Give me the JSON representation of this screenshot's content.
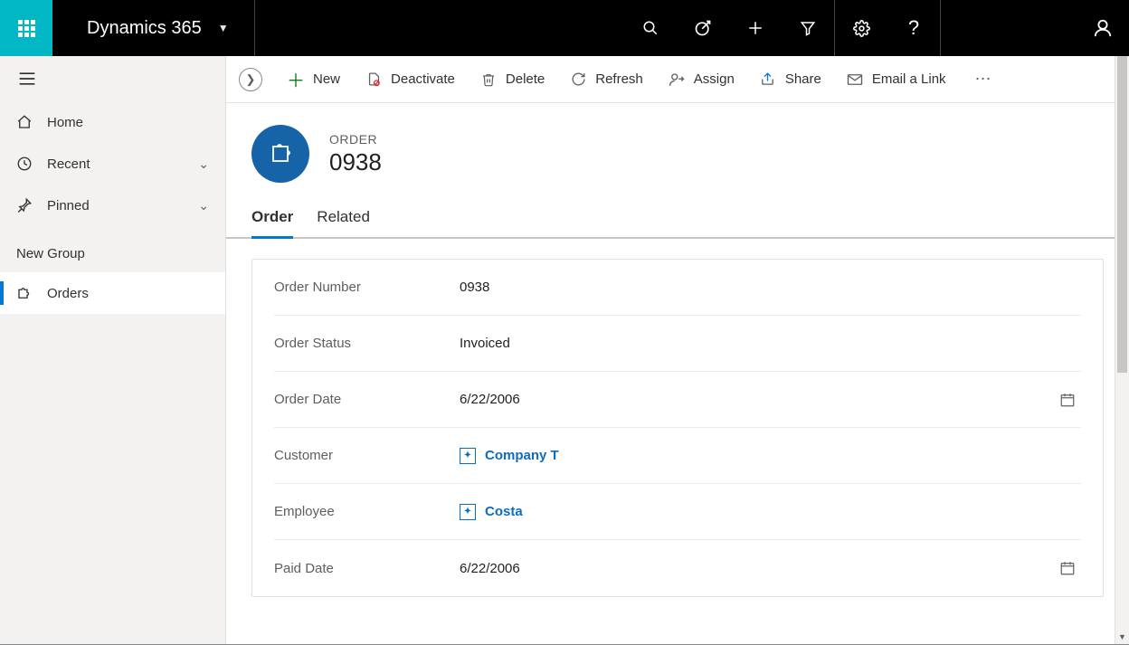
{
  "topbar": {
    "brand": "Dynamics 365"
  },
  "sidebar": {
    "home": "Home",
    "recent": "Recent",
    "pinned": "Pinned",
    "group_heading": "New Group",
    "orders": "Orders"
  },
  "commands": {
    "new": "New",
    "deactivate": "Deactivate",
    "delete": "Delete",
    "refresh": "Refresh",
    "assign": "Assign",
    "share": "Share",
    "email_link": "Email a Link"
  },
  "record": {
    "entity_label": "ORDER",
    "name": "0938"
  },
  "tabs": {
    "order": "Order",
    "related": "Related"
  },
  "form": {
    "order_number": {
      "label": "Order Number",
      "value": "0938"
    },
    "order_status": {
      "label": "Order Status",
      "value": "Invoiced"
    },
    "order_date": {
      "label": "Order Date",
      "value": "6/22/2006"
    },
    "customer": {
      "label": "Customer",
      "value": "Company T"
    },
    "employee": {
      "label": "Employee",
      "value": "Costa"
    },
    "paid_date": {
      "label": "Paid Date",
      "value": "6/22/2006"
    }
  }
}
